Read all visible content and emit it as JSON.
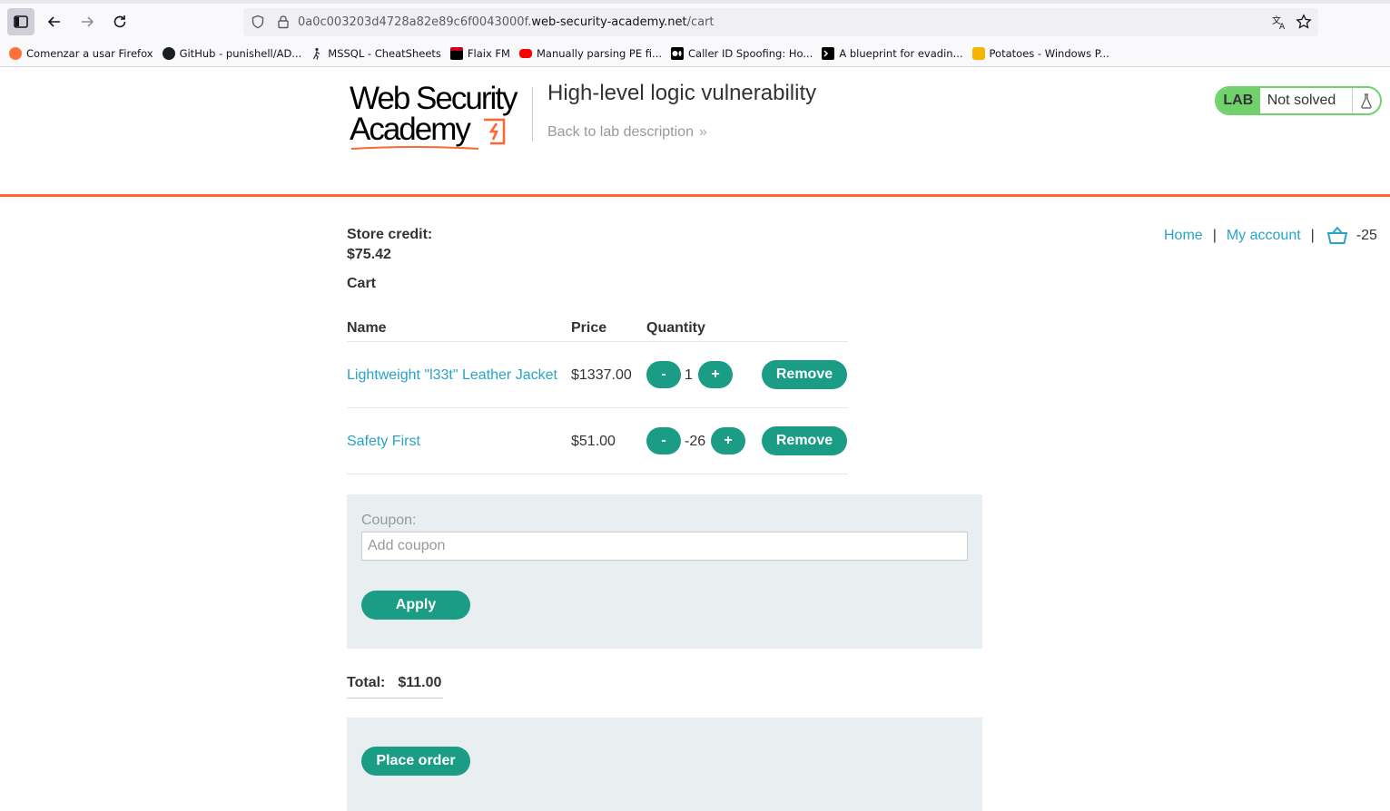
{
  "browser": {
    "url_prefix": "0a0c003203d4728a82e89c6f0043000f.",
    "url_domain": "web-security-academy.net",
    "url_path": "/cart",
    "bookmarks": [
      {
        "label": "Comenzar a usar Firefox",
        "icon": "firefox-icon",
        "color": "#ff7139"
      },
      {
        "label": "GitHub - punishell/AD...",
        "icon": "github-icon",
        "color": "#1b1f23"
      },
      {
        "label": "MSSQL - CheatSheets",
        "icon": "walker-icon",
        "color": "#333333"
      },
      {
        "label": "Flaix FM",
        "icon": "flaix-icon",
        "color": "#c4001a"
      },
      {
        "label": "Manually parsing PE fi...",
        "icon": "youtube-icon",
        "color": "#ff0000"
      },
      {
        "label": "Caller ID Spoofing: Ho...",
        "icon": "medium-icon",
        "color": "#000000"
      },
      {
        "label": "A blueprint for evadin...",
        "icon": "terminal-icon",
        "color": "#000000"
      },
      {
        "label": "Potatoes - Windows P...",
        "icon": "potato-icon",
        "color": "#f4b400"
      }
    ]
  },
  "header": {
    "logo_line1": "Web Security",
    "logo_line2": "Academy",
    "lab_title": "High-level logic vulnerability",
    "back_link": "Back to lab description",
    "back_chevron": "»",
    "lab_badge": "LAB",
    "lab_state": "Not solved"
  },
  "store": {
    "credit_label": "Store credit:",
    "credit_value": "$75.42",
    "cart_heading": "Cart"
  },
  "nav": {
    "home": "Home",
    "separator": "|",
    "my_account": "My account",
    "cart_count": "-25"
  },
  "cart": {
    "columns": [
      "Name",
      "Price",
      "Quantity"
    ],
    "items": [
      {
        "name": "Lightweight \"l33t\" Leather Jacket",
        "price": "$1337.00",
        "quantity": "1"
      },
      {
        "name": "Safety First",
        "price": "$51.00",
        "quantity": "-26"
      }
    ],
    "minus_label": "-",
    "plus_label": "+",
    "remove_label": "Remove"
  },
  "coupon": {
    "label": "Coupon:",
    "placeholder": "Add coupon",
    "apply_label": "Apply"
  },
  "total": {
    "label": "Total:",
    "value": "$11.00"
  },
  "order": {
    "place_order_label": "Place order"
  },
  "colors": {
    "accent_orange": "#ff6633",
    "button_green": "#1a9c85",
    "link_blue": "#29a3c7",
    "lab_green": "#70d16d"
  }
}
